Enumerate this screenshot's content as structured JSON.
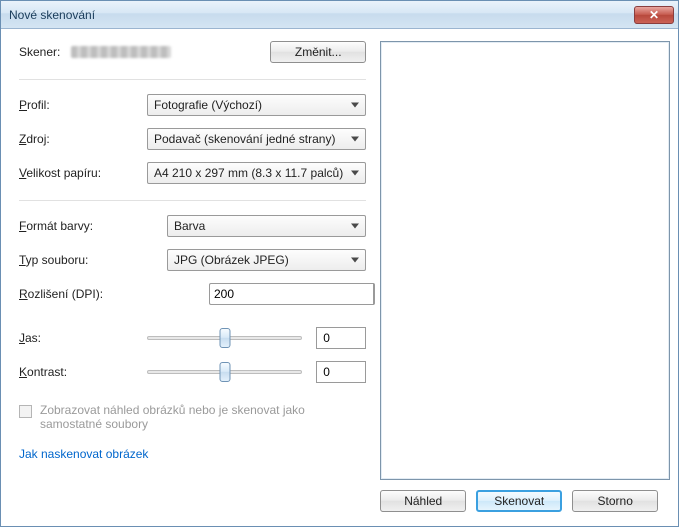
{
  "window": {
    "title": "Nové skenování"
  },
  "scanner": {
    "label": "Skener:",
    "change_button": "Změnit..."
  },
  "profile": {
    "label": "Profil:",
    "hotkey": "P",
    "value": "Fotografie (Výchozí)"
  },
  "source": {
    "label": "Zdroj:",
    "hotkey": "Z",
    "value": "Podavač (skenování jedné strany)"
  },
  "paper": {
    "label": "Velikost papíru:",
    "hotkey": "V",
    "value": "A4 210 x 297 mm (8.3 x 11.7 palců)"
  },
  "color": {
    "label": "Formát barvy:",
    "hotkey": "F",
    "value": "Barva"
  },
  "filetype": {
    "label": "Typ souboru:",
    "hotkey": "T",
    "value": "JPG (Obrázek JPEG)"
  },
  "dpi": {
    "label": "Rozlišení (DPI):",
    "hotkey": "R",
    "value": "200"
  },
  "brightness": {
    "label": "Jas:",
    "hotkey": "J",
    "value": "0"
  },
  "contrast": {
    "label": "Kontrast:",
    "hotkey": "K",
    "value": "0"
  },
  "checkbox": {
    "label": "Zobrazovat náhled obrázků nebo je skenovat jako samostatné soubory",
    "checked": false,
    "enabled": false
  },
  "help_link": "Jak naskenovat obrázek",
  "buttons": {
    "preview": "Náhled",
    "scan": "Skenovat",
    "cancel": "Storno"
  }
}
